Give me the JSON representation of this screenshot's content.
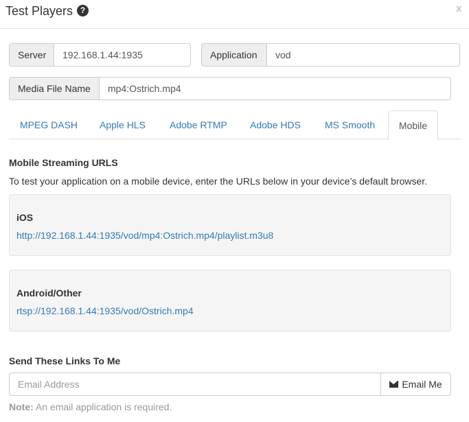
{
  "dialog": {
    "title": "Test Players",
    "help_icon": "question-circle-icon",
    "close_label": "x"
  },
  "form": {
    "server_label": "Server",
    "server_value": "192.168.1.44:1935",
    "application_label": "Application",
    "application_value": "vod",
    "media_label": "Media File Name",
    "media_value": "mp4:Ostrich.mp4"
  },
  "tabs": [
    {
      "label": "MPEG DASH"
    },
    {
      "label": "Apple HLS"
    },
    {
      "label": "Adobe RTMP"
    },
    {
      "label": "Adobe HDS"
    },
    {
      "label": "MS Smooth"
    },
    {
      "label": "Mobile"
    }
  ],
  "active_tab": "Mobile",
  "mobile": {
    "heading": "Mobile Streaming URLS",
    "description": "To test your application on a mobile device, enter the URLs below in your device’s default browser.",
    "ios_label": "iOS",
    "ios_url": "http://192.168.1.44:1935/vod/mp4:Ostrich.mp4/playlist.m3u8",
    "android_label": "Android/Other",
    "android_url": "rtsp://192.168.1.44:1935/vod/Ostrich.mp4"
  },
  "send": {
    "heading": "Send These Links To Me",
    "email_placeholder": "Email Address",
    "button_label": "Email Me",
    "button_icon": "envelope-icon",
    "note_label": "Note:",
    "note_text": "An email application is required."
  },
  "colors": {
    "link": "#337ab7",
    "well_background": "#f5f5f5",
    "addon_background": "#eeeeee",
    "muted_text": "#999999"
  }
}
